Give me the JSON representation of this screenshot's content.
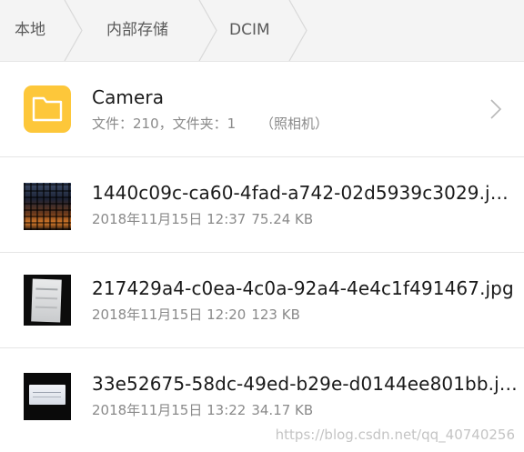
{
  "breadcrumb": {
    "items": [
      {
        "label": "本地"
      },
      {
        "label": "内部存储"
      },
      {
        "label": "DCIM"
      }
    ]
  },
  "folder": {
    "name": "Camera",
    "files_label": "文件：210，文件夹：1",
    "alias": "（照相机）",
    "icon": "folder-icon",
    "icon_color": "#fdc73a"
  },
  "files": [
    {
      "name": "1440c09c-ca60-4fad-a742-02d5939c3029.j…",
      "date": "2018年11月15日 12:37",
      "size": "75.24 KB"
    },
    {
      "name": "217429a4-c0ea-4c0a-92a4-4e4c1f491467.jpg",
      "date": "2018年11月15日 12:20",
      "size": "123 KB"
    },
    {
      "name": "33e52675-58dc-49ed-b29e-d0144ee801bb.j…",
      "date": "2018年11月15日 13:22",
      "size": "34.17 KB"
    }
  ],
  "watermark": "https://blog.csdn.net/qq_40740256",
  "colors": {
    "breadcrumb_bg": "#f4f4f4",
    "divider": "#e6e6e6",
    "primary_text": "#1a1a1a",
    "secondary_text": "#8a8a8a"
  }
}
